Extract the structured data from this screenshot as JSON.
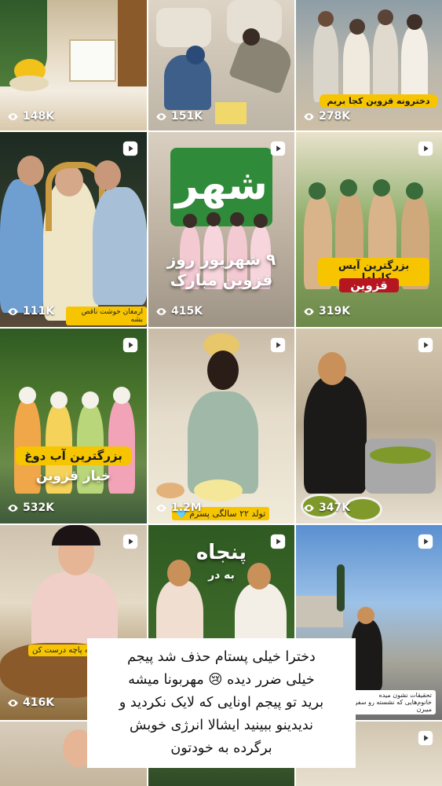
{
  "tiles": [
    {
      "views": "148K",
      "reel": false
    },
    {
      "views": "151K",
      "reel": false
    },
    {
      "views": "278K",
      "reel": false,
      "caption": "دخترونه قزوین کجا بریم"
    },
    {
      "views": "111K",
      "reel": true,
      "caption": "ارمغان خوشت ناقص بشه"
    },
    {
      "views": "415K",
      "reel": true,
      "caption_line1": "۹ شهریور روز",
      "caption_line2": "قزوین مبارک",
      "sign": "شهر"
    },
    {
      "views": "319K",
      "reel": true,
      "caption_line1": "بزرگترین آیس کارامل",
      "caption_line2": "قزوین"
    },
    {
      "views": "532K",
      "reel": true,
      "caption_line1": "بزرگترین آب دوغ",
      "caption_line2": "خیار قزوین"
    },
    {
      "views": "1.2M",
      "reel": true,
      "caption": "تولد ۲۲ سالگی پسرم 🩵"
    },
    {
      "views": "347K",
      "reel": true
    },
    {
      "views": "416K",
      "reel": true,
      "caption": "کله پاچه درست کن"
    },
    {
      "views": "",
      "reel": true,
      "caption_line1": "پنجاه",
      "caption_line2": "به در"
    },
    {
      "views": "",
      "reel": true,
      "caption": "تحقیقات نشون میده خانوم‌هایی که نشسته رو سفر میبرن"
    },
    {
      "views": "",
      "reel": false
    },
    {
      "views": "",
      "reel": false
    },
    {
      "views": "",
      "reel": true
    }
  ],
  "popup": {
    "line1": "دخترا خیلی پستام حذف شد پیجم",
    "line2": "خیلی ضرر دیده 😢 مهربونا میشه",
    "line3": "برید تو پیجم اونایی که لایک نکردید و",
    "line4": "ندیدینو ببینید ایشالا انرژی خوبش",
    "line5": "برگرده به خودتون"
  },
  "colors": {
    "caption_yellow": "#f6c500",
    "popup_bg": "#ffffff",
    "text_white": "#ffffff"
  }
}
